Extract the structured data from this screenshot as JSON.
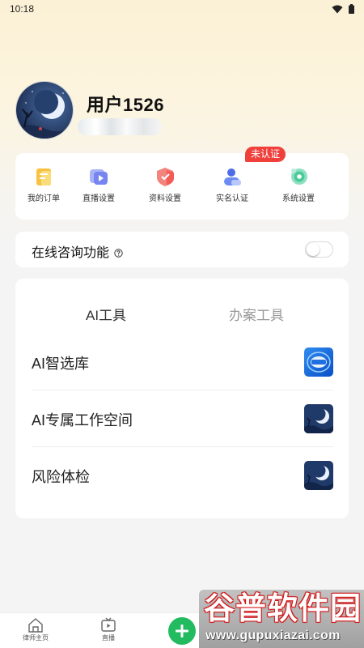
{
  "status_bar": {
    "time": "10:18"
  },
  "profile": {
    "name": "用户1526"
  },
  "menu": {
    "items": [
      {
        "label": "我的订单",
        "icon": "order-icon"
      },
      {
        "label": "直播设置",
        "icon": "live-settings-icon"
      },
      {
        "label": "资料设置",
        "icon": "profile-settings-icon"
      },
      {
        "label": "实名认证",
        "icon": "id-verify-icon"
      },
      {
        "label": "系统设置",
        "icon": "system-settings-icon"
      }
    ],
    "verify_badge": "未认证"
  },
  "consult": {
    "label": "在线咨询功能",
    "enabled": false
  },
  "tools": {
    "tabs": [
      {
        "label": "AI工具",
        "active": true
      },
      {
        "label": "办案工具",
        "active": false
      }
    ],
    "rows": [
      {
        "label": "AI智选库",
        "icon": "ai-library-icon"
      },
      {
        "label": "AI专属工作空间",
        "icon": "moon-thumbnail-icon"
      },
      {
        "label": "风险体检",
        "icon": "moon-thumbnail-icon"
      }
    ]
  },
  "bottom_nav": {
    "items": [
      {
        "label": "律师主页",
        "icon": "home-icon"
      },
      {
        "label": "直播",
        "icon": "tv-icon"
      }
    ],
    "fab_icon": "plus-icon"
  },
  "watermark": {
    "title": "谷普软件园",
    "url": "www.gupuxiazai.com"
  },
  "colors": {
    "accent_green": "#22bb60",
    "badge_red": "#f0403c",
    "header_gradient_top": "#fbf1d6"
  }
}
